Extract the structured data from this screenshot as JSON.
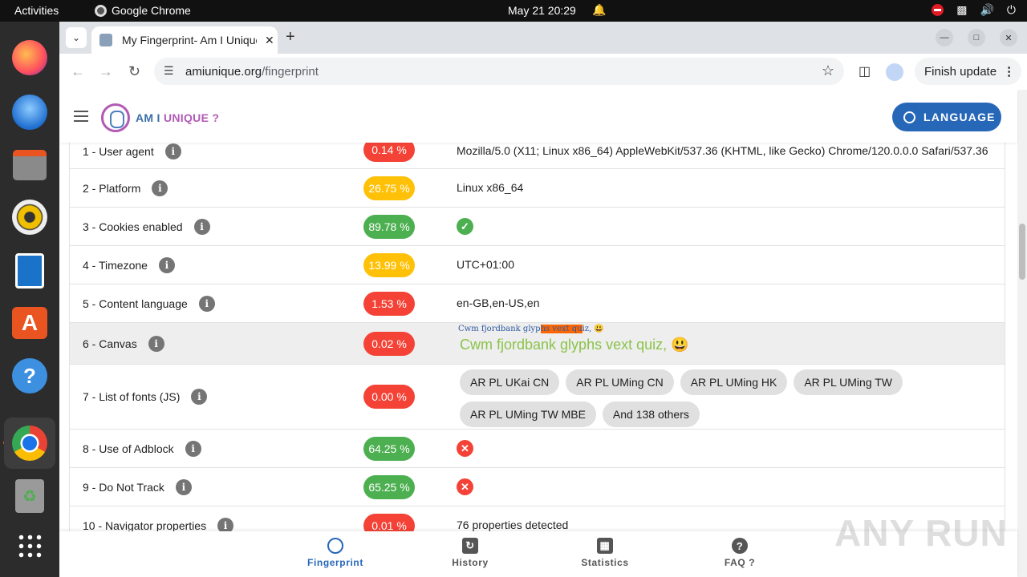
{
  "topbar": {
    "activities": "Activities",
    "app_name": "Google Chrome",
    "clock": "May 21  20:29"
  },
  "dock": {
    "apps": [
      "firefox",
      "thunderbird",
      "files",
      "rhythmbox",
      "libreoffice-writer",
      "app-center",
      "help",
      "chrome",
      "trash",
      "show-apps"
    ]
  },
  "browser": {
    "tab_title": "My Fingerprint- Am I Unique",
    "url_domain": "amiunique.org",
    "url_path": "/fingerprint",
    "update_label": "Finish update"
  },
  "site": {
    "logo_am": "AM I",
    "logo_unique": "UNIQUE ?",
    "language_label": "LANGUAGE"
  },
  "rows": [
    {
      "label": "1 - User agent",
      "pct": "0.14 %",
      "color": "red",
      "value": "Mozilla/5.0 (X11; Linux x86_64) AppleWebKit/537.36 (KHTML, like Gecko) Chrome/120.0.0.0 Safari/537.36"
    },
    {
      "label": "2 - Platform",
      "pct": "26.75 %",
      "color": "yellow",
      "value": "Linux x86_64"
    },
    {
      "label": "3 - Cookies enabled",
      "pct": "89.78 %",
      "color": "green",
      "value": "check"
    },
    {
      "label": "4 - Timezone",
      "pct": "13.99 %",
      "color": "yellow",
      "value": "UTC+01:00"
    },
    {
      "label": "5 - Content language",
      "pct": "1.53 %",
      "color": "red",
      "value": "en-GB,en-US,en"
    },
    {
      "label": "6 - Canvas",
      "pct": "0.02 %",
      "color": "red",
      "canvas_small_a": "Cwm fjordbank glyp",
      "canvas_small_hl": "hs vext qu",
      "canvas_small_b": "iz, 😃",
      "canvas_big": "Cwm fjordbank glyphs vext quiz, 😃"
    },
    {
      "label": "7 - List of fonts (JS)",
      "pct": "0.00 %",
      "color": "red",
      "fonts": [
        "AR PL UKai CN",
        "AR PL UMing CN",
        "AR PL UMing HK",
        "AR PL UMing TW",
        "AR PL UMing TW MBE",
        "And 138 others"
      ]
    },
    {
      "label": "8 - Use of Adblock",
      "pct": "64.25 %",
      "color": "green",
      "value": "cross"
    },
    {
      "label": "9 - Do Not Track",
      "pct": "65.25 %",
      "color": "green",
      "value": "cross"
    },
    {
      "label": "10 - Navigator properties",
      "pct": "0.01 %",
      "color": "red",
      "value": "76 properties detected"
    }
  ],
  "bottom_nav": {
    "fingerprint": "Fingerprint",
    "history": "History",
    "statistics": "Statistics",
    "faq": "FAQ ?"
  },
  "watermark": "ANY RUN",
  "colors": {
    "red": "#f44336",
    "yellow": "#ffc107",
    "green": "#4caf50",
    "accent": "#2667b8"
  }
}
